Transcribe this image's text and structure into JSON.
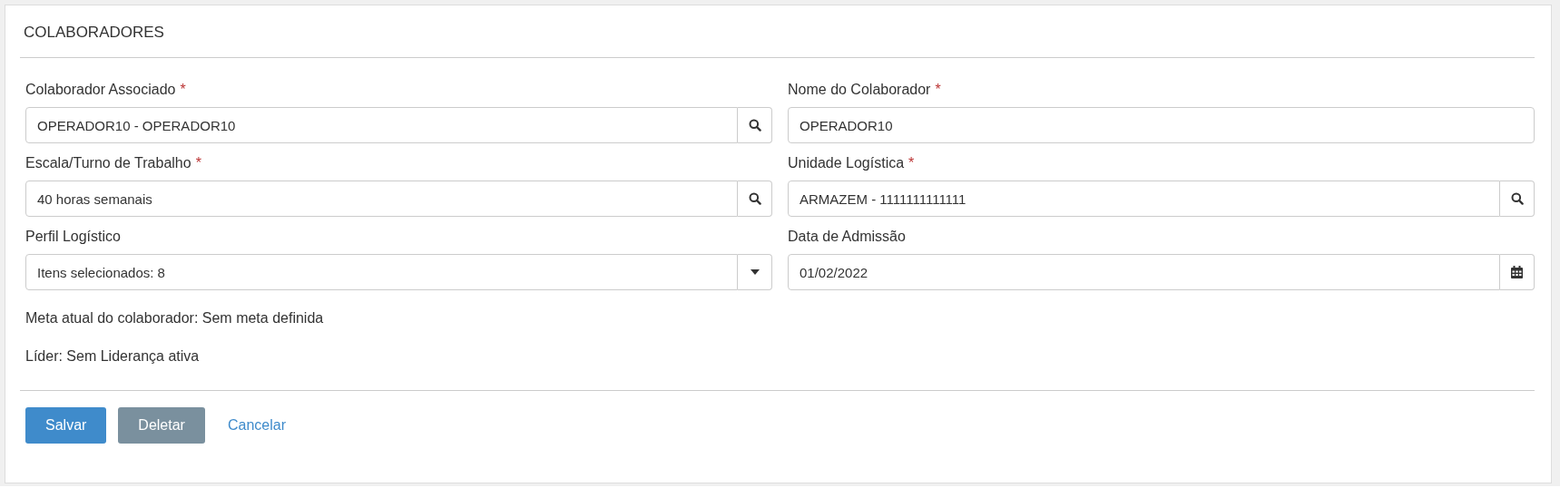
{
  "panel": {
    "title": "COLABORADORES"
  },
  "fields": [
    {
      "label": "Colaborador Associado",
      "required": true,
      "value": "OPERADOR10 - OPERADOR10",
      "kind": "search"
    },
    {
      "label": "Nome do Colaborador",
      "required": true,
      "value": "OPERADOR10",
      "kind": "plain"
    },
    {
      "label": "Escala/Turno de Trabalho",
      "required": true,
      "value": "40 horas semanais",
      "kind": "search"
    },
    {
      "label": "Unidade Logística",
      "required": true,
      "value": "ARMAZEM - 1111111111111",
      "kind": "search"
    },
    {
      "label": "Perfil Logístico",
      "required": false,
      "value": "Itens selecionados: 8",
      "kind": "dropdown"
    },
    {
      "label": "Data de Admissão",
      "required": false,
      "value": "01/02/2022",
      "kind": "calendar"
    }
  ],
  "info": [
    "Meta atual do colaborador: Sem meta definida",
    "Líder: Sem Liderança ativa"
  ],
  "required_mark": "*",
  "buttons": [
    {
      "label": "Salvar",
      "kind": "primary"
    },
    {
      "label": "Deletar",
      "kind": "secondary"
    },
    {
      "label": "Cancelar",
      "kind": "link"
    }
  ]
}
